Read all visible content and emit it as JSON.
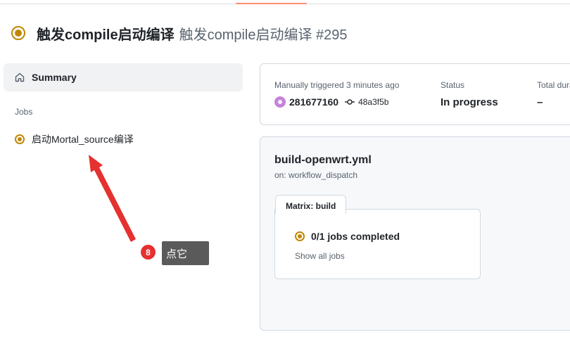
{
  "header": {
    "title": "触发compile启动编译",
    "run_name": "触发compile启动编译 #295",
    "status_color": "#bf8700"
  },
  "sidebar": {
    "summary_label": "Summary",
    "summary_icon": "home-icon",
    "jobs_heading": "Jobs",
    "jobs": [
      {
        "label": "启动Mortal_source编译",
        "status": "in-progress"
      }
    ]
  },
  "annotation": {
    "step_number": "8",
    "tooltip_text": "点它",
    "arrow_color": "#e5312f"
  },
  "run_info": {
    "trigger_label": "Manually triggered 3 minutes ago",
    "user_id": "281677160",
    "commit_sha": "48a3f5b",
    "status_label": "Status",
    "status_value": "In progress",
    "duration_label": "Total duration",
    "duration_value": "–"
  },
  "workflow": {
    "file": "build-openwrt.yml",
    "trigger": "on: workflow_dispatch",
    "matrix_tab": "Matrix: build",
    "jobs_completed": "0/1 jobs completed",
    "show_all": "Show all jobs"
  },
  "colors": {
    "accent_tab": "#fd8c73",
    "in_progress": "#bf8700",
    "tooltip_bg": "#5a5a5a"
  }
}
